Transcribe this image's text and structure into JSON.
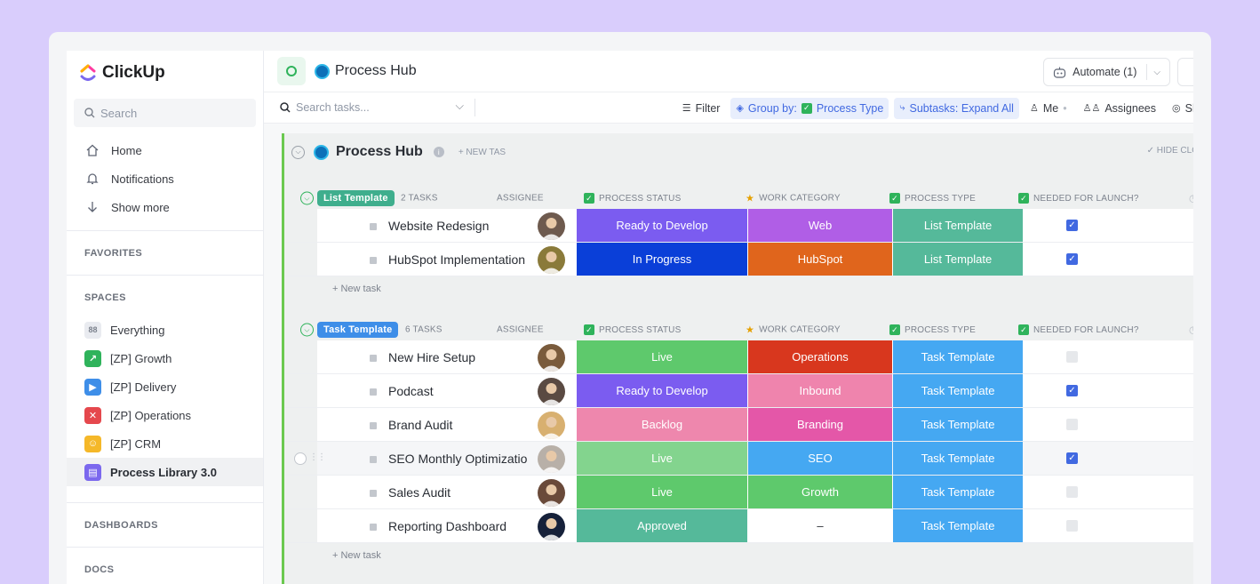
{
  "brand": {
    "name": "ClickUp"
  },
  "sidebar": {
    "search_placeholder": "Search",
    "nav": [
      {
        "label": "Home",
        "icon": "home-icon"
      },
      {
        "label": "Notifications",
        "icon": "bell-icon"
      },
      {
        "label": "Show more",
        "icon": "arrow-down-icon"
      }
    ],
    "sections": {
      "favorites": "FAVORITES",
      "spaces": "SPACES",
      "dashboards": "DASHBOARDS",
      "docs": "DOCS"
    },
    "spaces": [
      {
        "label": "Everything",
        "color": "#e9ebf0",
        "glyph": "88"
      },
      {
        "label": "[ZP] Growth",
        "color": "#2fb35b",
        "glyph": "↗"
      },
      {
        "label": "[ZP] Delivery",
        "color": "#3e8ee8",
        "glyph": "▶"
      },
      {
        "label": "[ZP] Operations",
        "color": "#e5484d",
        "glyph": "✕"
      },
      {
        "label": "[ZP] CRM",
        "color": "#f5b829",
        "glyph": "☺"
      },
      {
        "label": "Process Library 3.0",
        "color": "#7b68ee",
        "glyph": "▤"
      }
    ]
  },
  "header": {
    "title": "Process Hub",
    "automate_label": "Automate (1)"
  },
  "toolbar": {
    "search_placeholder": "Search tasks...",
    "filter": "Filter",
    "group_by": "Group by:",
    "group_by_value": "Process Type",
    "subtasks": "Subtasks: Expand All",
    "me": "Me",
    "assignees": "Assignees",
    "show": "Sh"
  },
  "list": {
    "title": "Process Hub",
    "new_task_inline": "+ NEW TAS",
    "hide_closed": "HIDE CLO"
  },
  "columns": {
    "assignee": "ASSIGNEE",
    "status": "PROCESS STATUS",
    "category": "WORK CATEGORY",
    "type": "PROCESS TYPE",
    "launch": "NEEDED FOR LAUNCH?"
  },
  "groups": [
    {
      "label": "List Template",
      "color": "#3fae8d",
      "count": "2 TASKS",
      "new_task": "+ New task",
      "rows": [
        {
          "name": "Website Redesign",
          "status": "Ready to Develop",
          "status_color": "#7b5cf0",
          "category": "Web",
          "category_color": "#b05ee6",
          "type": "List Template",
          "type_color": "#55b99a",
          "launch": true,
          "avatar": "#6e5a4e"
        },
        {
          "name": "HubSpot Implementation",
          "status": "In Progress",
          "status_color": "#0a3fd8",
          "category": "HubSpot",
          "category_color": "#e0651c",
          "type": "List Template",
          "type_color": "#55b99a",
          "launch": true,
          "avatar": "#8a7a3a"
        }
      ]
    },
    {
      "label": "Task Template",
      "color": "#3e8ee8",
      "count": "6 TASKS",
      "new_task": "+ New task",
      "rows": [
        {
          "name": "New Hire Setup",
          "status": "Live",
          "status_color": "#5ec96c",
          "category": "Operations",
          "category_color": "#d8371e",
          "type": "Task Template",
          "type_color": "#45a8f2",
          "launch": false,
          "avatar": "#7a5b3c"
        },
        {
          "name": "Podcast",
          "status": "Ready to Develop",
          "status_color": "#7b5cf0",
          "category": "Inbound",
          "category_color": "#ef84ad",
          "type": "Task Template",
          "type_color": "#45a8f2",
          "launch": true,
          "avatar": "#5a4a42"
        },
        {
          "name": "Brand Audit",
          "status": "Backlog",
          "status_color": "#ee87ad",
          "category": "Branding",
          "category_color": "#e457a8",
          "type": "Task Template",
          "type_color": "#45a8f2",
          "launch": false,
          "avatar": "#d8b070"
        },
        {
          "name": "SEO Monthly Optimizatio",
          "status": "Live",
          "status_color": "#83d48e",
          "category": "SEO",
          "category_color": "#45a8f2",
          "type": "Task Template",
          "type_color": "#45a8f2",
          "launch": true,
          "avatar": "#b8b0a8"
        },
        {
          "name": "Sales Audit",
          "status": "Live",
          "status_color": "#5ec96c",
          "category": "Growth",
          "category_color": "#5ec96c",
          "type": "Task Template",
          "type_color": "#45a8f2",
          "launch": false,
          "avatar": "#6a4a3a"
        },
        {
          "name": "Reporting Dashboard",
          "status": "Approved",
          "status_color": "#55b99a",
          "category": "–",
          "category_color": "#ffffff",
          "type": "Task Template",
          "type_color": "#45a8f2",
          "launch": false,
          "avatar": "#16213a"
        }
      ]
    }
  ]
}
